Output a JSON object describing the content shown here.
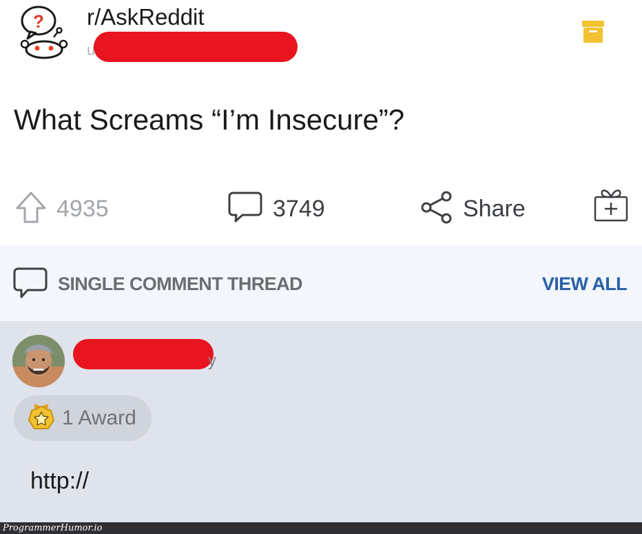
{
  "post": {
    "subreddit": "r/AskReddit",
    "author_prefix": "u",
    "title": "What Screams “I’m Insecure”?",
    "subreddit_icon": "askreddit-snoo-icon",
    "save_icon": "archive-icon"
  },
  "actions": {
    "upvotes": "4935",
    "comments": "3749",
    "share_label": "Share",
    "upvote_icon": "upvote-arrow-icon",
    "comment_icon": "comment-bubble-icon",
    "share_icon": "share-icon",
    "gift_icon": "gift-icon"
  },
  "thread": {
    "label": "SINGLE COMMENT THREAD",
    "view_all": "VIEW ALL"
  },
  "comment": {
    "username_tail": "y",
    "award_label": "1 Award",
    "award_icon": "award-badge-icon",
    "body": "http://"
  },
  "watermark": {
    "text": "ProgrammerHumor.io"
  },
  "colors": {
    "redaction": "#e8141f",
    "archive_icon": "#f2c230",
    "view_all": "#2a5fa8",
    "thread_bar_bg": "#f3f6fb",
    "comment_bg": "#dfe3ec"
  }
}
